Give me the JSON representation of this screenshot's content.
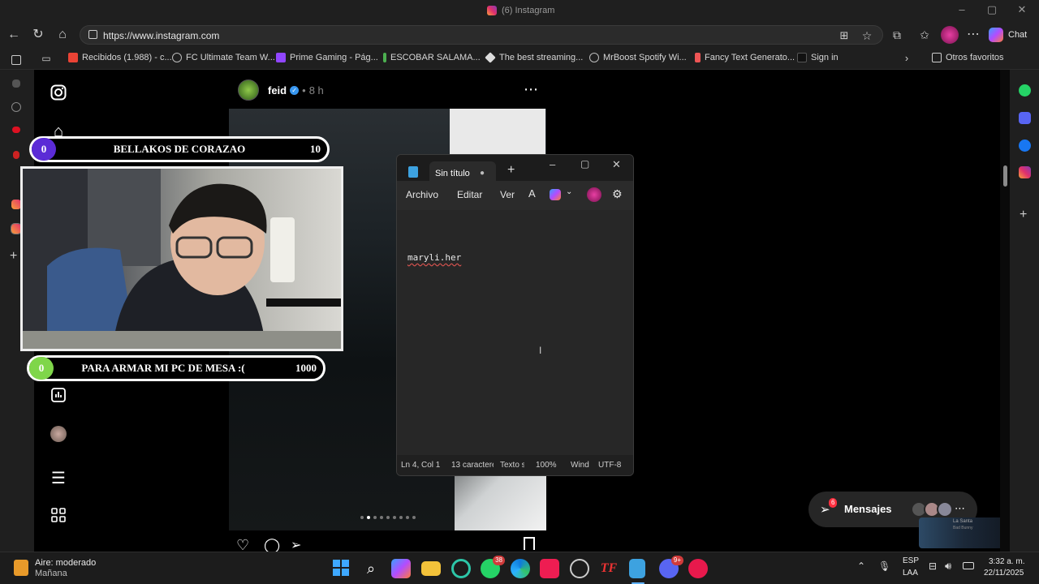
{
  "window": {
    "title": "(6) Instagram"
  },
  "browser": {
    "url": "https://www.instagram.com",
    "chat_label": "Chat",
    "bookmarks": [
      "Recibidos (1.988) - c...",
      "FC Ultimate Team W...",
      "Prime Gaming - Pág...",
      "ESCOBAR SALAMA...",
      "The best streaming...",
      "MrBoost Spotify Wi...",
      "Fancy Text Generato...",
      "Sign in"
    ],
    "other_favorites": "Otros favoritos"
  },
  "post": {
    "username": "feid",
    "time": "8 h",
    "more": "⋯",
    "carousel_count": 9,
    "carousel_active": 1
  },
  "overlay": {
    "goal1": {
      "count": "0",
      "text": "BELLAKOS DE CORAZAO",
      "target": "10"
    },
    "goal2": {
      "count": "0",
      "text": "PARA ARMAR MI PC DE MESA :(",
      "target": "1000"
    }
  },
  "notepad": {
    "tab_title": "Sin título",
    "menu": [
      "Archivo",
      "Editar",
      "Ver"
    ],
    "content": "maryli.her",
    "status": {
      "position": "Ln 4, Col 1",
      "chars": "13 caractere",
      "text": "Texto s",
      "zoom": "100%",
      "eol": "Wind",
      "encoding": "UTF-8"
    }
  },
  "messages": {
    "label": "Mensajes",
    "badge": "6",
    "more": "⋯"
  },
  "music_widget": {
    "title": "La Santa",
    "artist": "Bad Bunny"
  },
  "taskbar": {
    "weather_title": "Aire: moderado",
    "weather_sub": "Mañana",
    "whatsapp_badge": "38",
    "discord_badge": "9+",
    "lang_top": "ESP",
    "lang_bottom": "LAA",
    "time": "3:32 a. m.",
    "date": "22/11/2025"
  },
  "colors": {
    "goal1_num": "#5b2bd6",
    "goal2_num": "#7fd64a",
    "taskbar_bg": "#1c1c1c"
  }
}
